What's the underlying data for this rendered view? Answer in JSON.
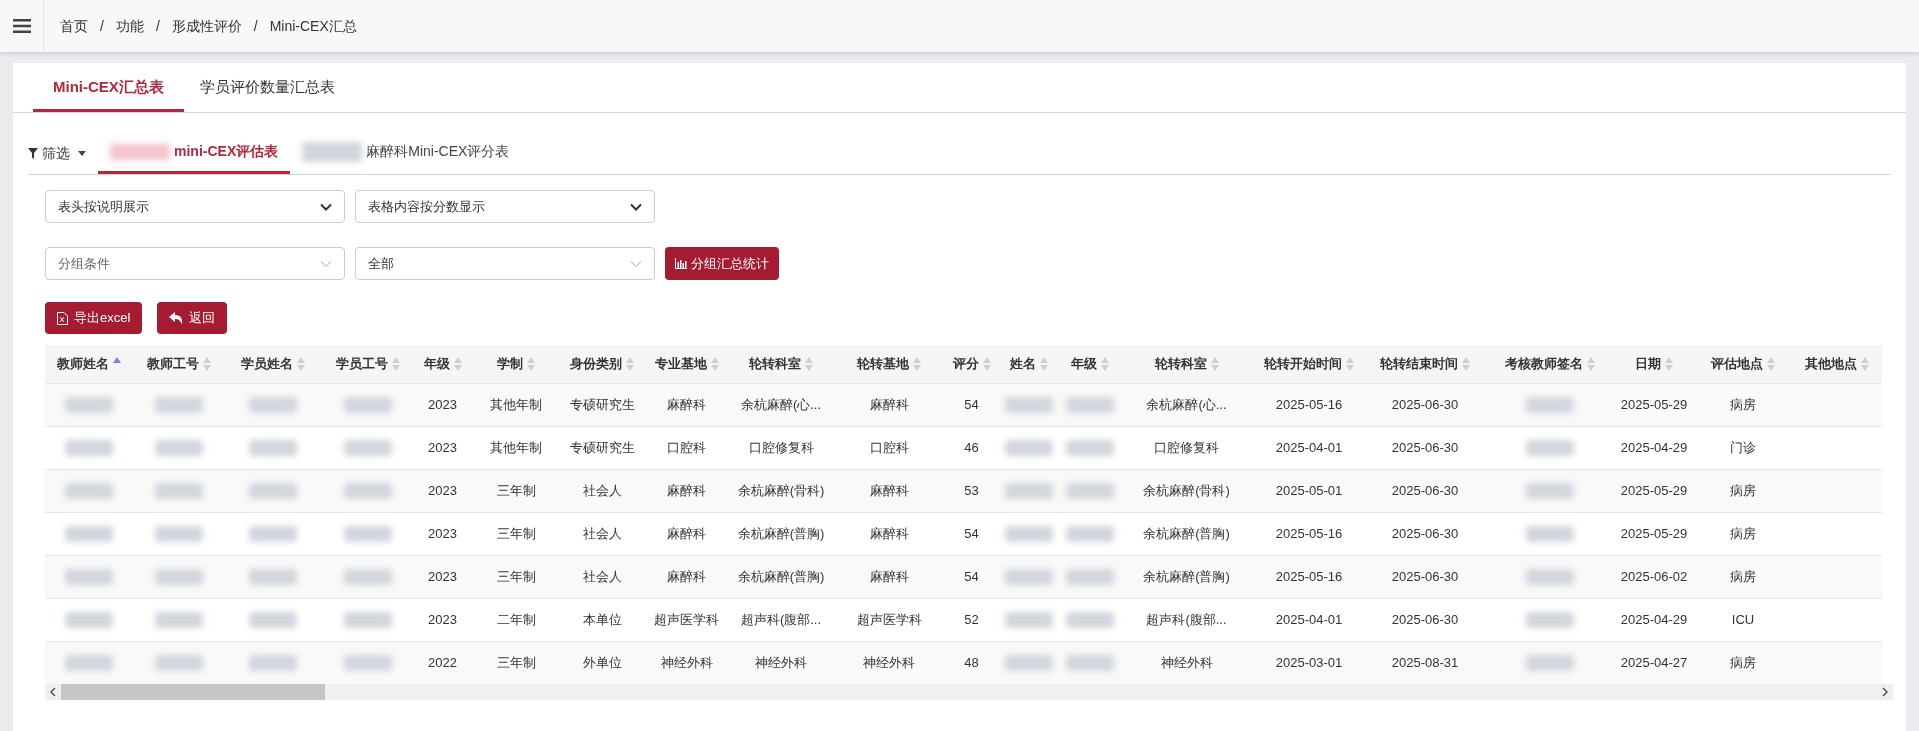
{
  "breadcrumb": [
    {
      "label": "首页"
    },
    {
      "separator": "/",
      "label": "功能"
    },
    {
      "separator": "/",
      "label": "形成性评价"
    },
    {
      "separator": "/",
      "label": "Mini-CEX汇总"
    }
  ],
  "tabs": [
    {
      "label": "Mini-CEX汇总表",
      "selected": true
    },
    {
      "label": "学员评价数量汇总表",
      "selected": false
    }
  ],
  "filter": {
    "label": "筛选"
  },
  "subtabs": [
    {
      "label": "mini-CEX评估表",
      "selected": true,
      "redacted_prefix": true
    },
    {
      "label": "麻醉科Mini-CEX评分表",
      "selected": false,
      "redacted_prefix": true
    }
  ],
  "selects": [
    {
      "value": "表头按说明展示",
      "kind": "native"
    },
    {
      "value": "表格内容按分数显示",
      "kind": "native"
    }
  ],
  "group_selects": [
    {
      "placeholder": "分组条件"
    },
    {
      "value": "全部"
    }
  ],
  "group_button": {
    "label": "分组汇总统计"
  },
  "actions": [
    {
      "label": "导出excel",
      "kind": "export"
    },
    {
      "label": "返回",
      "kind": "back"
    }
  ],
  "table": {
    "columns": [
      {
        "label": "教师姓名",
        "sorted_ascending": true
      },
      {
        "label": "教师工号",
        "sorted_ascending": false
      },
      {
        "label": "学员姓名",
        "sorted_ascending": false
      },
      {
        "label": "学员工号",
        "sorted_ascending": false
      },
      {
        "label": "年级",
        "sorted_ascending": false
      },
      {
        "label": "学制",
        "sorted_ascending": false
      },
      {
        "label": "身份类别",
        "sorted_ascending": false
      },
      {
        "label": "专业基地",
        "sorted_ascending": false
      },
      {
        "label": "轮转科室",
        "sorted_ascending": false
      },
      {
        "label": "轮转基地",
        "sorted_ascending": false
      },
      {
        "label": "评分",
        "sorted_ascending": false
      },
      {
        "label": "姓名",
        "sorted_ascending": false
      },
      {
        "label": "年级",
        "sorted_ascending": false
      },
      {
        "label": "轮转科室",
        "sorted_ascending": false
      },
      {
        "label": "轮转开始时间",
        "sorted_ascending": false
      },
      {
        "label": "轮转结束时间",
        "sorted_ascending": false
      },
      {
        "label": "考核教师签名",
        "sorted_ascending": false
      },
      {
        "label": "日期",
        "sorted_ascending": false
      },
      {
        "label": "评估地点",
        "sorted_ascending": false
      },
      {
        "label": "其他地点",
        "sorted_ascending": false
      }
    ],
    "rows": [
      {
        "cells": [
          {
            "kind": "redacted"
          },
          {
            "kind": "redacted"
          },
          {
            "kind": "redacted"
          },
          {
            "kind": "redacted"
          },
          {
            "kind": "text",
            "text": "2023"
          },
          {
            "kind": "text",
            "text": "其他年制"
          },
          {
            "kind": "text",
            "text": "专硕研究生"
          },
          {
            "kind": "text",
            "text": "麻醉科"
          },
          {
            "kind": "text",
            "text": "余杭麻醉(心..."
          },
          {
            "kind": "text",
            "text": "麻醉科"
          },
          {
            "kind": "text",
            "text": "54"
          },
          {
            "kind": "redacted"
          },
          {
            "kind": "redacted"
          },
          {
            "kind": "text",
            "text": "余杭麻醉(心..."
          },
          {
            "kind": "text",
            "text": "2025-05-16"
          },
          {
            "kind": "text",
            "text": "2025-06-30"
          },
          {
            "kind": "redacted"
          },
          {
            "kind": "text",
            "text": "2025-05-29"
          },
          {
            "kind": "text",
            "text": "病房"
          },
          {
            "kind": "empty"
          }
        ]
      },
      {
        "cells": [
          {
            "kind": "redacted"
          },
          {
            "kind": "redacted"
          },
          {
            "kind": "redacted"
          },
          {
            "kind": "redacted"
          },
          {
            "kind": "text",
            "text": "2023"
          },
          {
            "kind": "text",
            "text": "其他年制"
          },
          {
            "kind": "text",
            "text": "专硕研究生"
          },
          {
            "kind": "text",
            "text": "口腔科"
          },
          {
            "kind": "text",
            "text": "口腔修复科"
          },
          {
            "kind": "text",
            "text": "口腔科"
          },
          {
            "kind": "text",
            "text": "46"
          },
          {
            "kind": "redacted"
          },
          {
            "kind": "redacted"
          },
          {
            "kind": "text",
            "text": "口腔修复科"
          },
          {
            "kind": "text",
            "text": "2025-04-01"
          },
          {
            "kind": "text",
            "text": "2025-06-30"
          },
          {
            "kind": "redacted"
          },
          {
            "kind": "text",
            "text": "2025-04-29"
          },
          {
            "kind": "text",
            "text": "门诊"
          },
          {
            "kind": "empty"
          }
        ]
      },
      {
        "cells": [
          {
            "kind": "redacted"
          },
          {
            "kind": "redacted"
          },
          {
            "kind": "redacted"
          },
          {
            "kind": "redacted"
          },
          {
            "kind": "text",
            "text": "2023"
          },
          {
            "kind": "text",
            "text": "三年制"
          },
          {
            "kind": "text",
            "text": "社会人"
          },
          {
            "kind": "text",
            "text": "麻醉科"
          },
          {
            "kind": "text",
            "text": "余杭麻醉(骨科)"
          },
          {
            "kind": "text",
            "text": "麻醉科"
          },
          {
            "kind": "text",
            "text": "53"
          },
          {
            "kind": "redacted"
          },
          {
            "kind": "redacted"
          },
          {
            "kind": "text",
            "text": "余杭麻醉(骨科)"
          },
          {
            "kind": "text",
            "text": "2025-05-01"
          },
          {
            "kind": "text",
            "text": "2025-06-30"
          },
          {
            "kind": "redacted"
          },
          {
            "kind": "text",
            "text": "2025-05-29"
          },
          {
            "kind": "text",
            "text": "病房"
          },
          {
            "kind": "empty"
          }
        ]
      },
      {
        "cells": [
          {
            "kind": "redacted"
          },
          {
            "kind": "redacted"
          },
          {
            "kind": "redacted"
          },
          {
            "kind": "redacted"
          },
          {
            "kind": "text",
            "text": "2023"
          },
          {
            "kind": "text",
            "text": "三年制"
          },
          {
            "kind": "text",
            "text": "社会人"
          },
          {
            "kind": "text",
            "text": "麻醉科"
          },
          {
            "kind": "text",
            "text": "余杭麻醉(普胸)"
          },
          {
            "kind": "text",
            "text": "麻醉科"
          },
          {
            "kind": "text",
            "text": "54"
          },
          {
            "kind": "redacted"
          },
          {
            "kind": "redacted"
          },
          {
            "kind": "text",
            "text": "余杭麻醉(普胸)"
          },
          {
            "kind": "text",
            "text": "2025-05-16"
          },
          {
            "kind": "text",
            "text": "2025-06-30"
          },
          {
            "kind": "redacted"
          },
          {
            "kind": "text",
            "text": "2025-05-29"
          },
          {
            "kind": "text",
            "text": "病房"
          },
          {
            "kind": "empty"
          }
        ]
      },
      {
        "cells": [
          {
            "kind": "redacted"
          },
          {
            "kind": "redacted"
          },
          {
            "kind": "redacted"
          },
          {
            "kind": "redacted"
          },
          {
            "kind": "text",
            "text": "2023"
          },
          {
            "kind": "text",
            "text": "三年制"
          },
          {
            "kind": "text",
            "text": "社会人"
          },
          {
            "kind": "text",
            "text": "麻醉科"
          },
          {
            "kind": "text",
            "text": "余杭麻醉(普胸)"
          },
          {
            "kind": "text",
            "text": "麻醉科"
          },
          {
            "kind": "text",
            "text": "54"
          },
          {
            "kind": "redacted"
          },
          {
            "kind": "redacted"
          },
          {
            "kind": "text",
            "text": "余杭麻醉(普胸)"
          },
          {
            "kind": "text",
            "text": "2025-05-16"
          },
          {
            "kind": "text",
            "text": "2025-06-30"
          },
          {
            "kind": "redacted"
          },
          {
            "kind": "text",
            "text": "2025-06-02"
          },
          {
            "kind": "text",
            "text": "病房"
          },
          {
            "kind": "empty"
          }
        ]
      },
      {
        "cells": [
          {
            "kind": "redacted"
          },
          {
            "kind": "redacted"
          },
          {
            "kind": "redacted"
          },
          {
            "kind": "redacted"
          },
          {
            "kind": "text",
            "text": "2023"
          },
          {
            "kind": "text",
            "text": "二年制"
          },
          {
            "kind": "text",
            "text": "本单位"
          },
          {
            "kind": "text",
            "text": "超声医学科"
          },
          {
            "kind": "text",
            "text": "超声科(腹部..."
          },
          {
            "kind": "text",
            "text": "超声医学科"
          },
          {
            "kind": "text",
            "text": "52"
          },
          {
            "kind": "redacted"
          },
          {
            "kind": "redacted"
          },
          {
            "kind": "text",
            "text": "超声科(腹部..."
          },
          {
            "kind": "text",
            "text": "2025-04-01"
          },
          {
            "kind": "text",
            "text": "2025-06-30"
          },
          {
            "kind": "redacted"
          },
          {
            "kind": "text",
            "text": "2025-04-29"
          },
          {
            "kind": "text",
            "text": "ICU"
          },
          {
            "kind": "empty"
          }
        ]
      },
      {
        "cells": [
          {
            "kind": "redacted"
          },
          {
            "kind": "redacted"
          },
          {
            "kind": "redacted"
          },
          {
            "kind": "redacted"
          },
          {
            "kind": "text",
            "text": "2022"
          },
          {
            "kind": "text",
            "text": "三年制"
          },
          {
            "kind": "text",
            "text": "外单位"
          },
          {
            "kind": "text",
            "text": "神经外科"
          },
          {
            "kind": "text",
            "text": "神经外科"
          },
          {
            "kind": "text",
            "text": "神经外科"
          },
          {
            "kind": "text",
            "text": "48"
          },
          {
            "kind": "redacted"
          },
          {
            "kind": "redacted"
          },
          {
            "kind": "text",
            "text": "神经外科"
          },
          {
            "kind": "text",
            "text": "2025-03-01"
          },
          {
            "kind": "text",
            "text": "2025-08-31"
          },
          {
            "kind": "redacted"
          },
          {
            "kind": "text",
            "text": "2025-04-27"
          },
          {
            "kind": "text",
            "text": "病房"
          },
          {
            "kind": "empty"
          }
        ]
      }
    ]
  }
}
